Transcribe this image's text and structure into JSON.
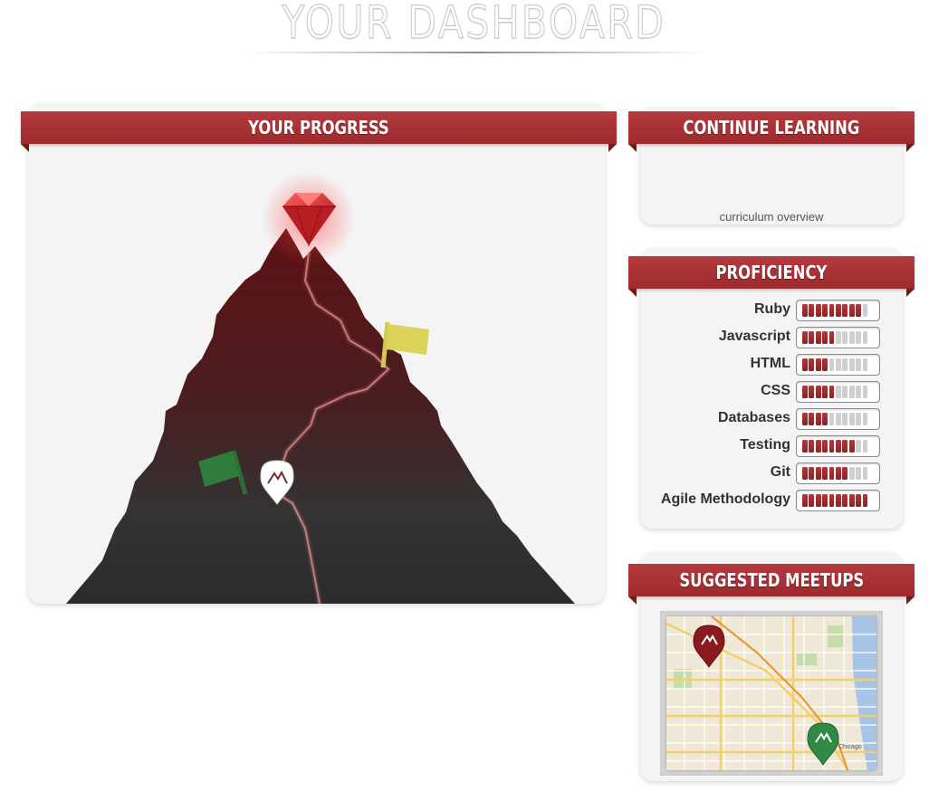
{
  "page": {
    "title": "YOUR DASHBOARD"
  },
  "progress": {
    "title": "YOUR PROGRESS"
  },
  "continue_learning": {
    "title": "CONTINUE LEARNING",
    "link_label": "curriculum overview"
  },
  "proficiency": {
    "title": "PROFICIENCY",
    "segments_per_meter": 10,
    "skills": [
      {
        "name": "Ruby",
        "level": 9
      },
      {
        "name": "Javascript",
        "level": 5
      },
      {
        "name": "HTML",
        "level": 4
      },
      {
        "name": "CSS",
        "level": 5
      },
      {
        "name": "Databases",
        "level": 4
      },
      {
        "name": "Testing",
        "level": 8
      },
      {
        "name": "Git",
        "level": 7
      },
      {
        "name": "Agile Methodology",
        "level": 10
      }
    ]
  },
  "meetups": {
    "title": "SUGGESTED MEETUPS",
    "map_labels": {
      "city": "Chicago"
    }
  },
  "colors": {
    "brand_red": "#a53035",
    "flag_yellow": "#dcd35a",
    "flag_green": "#2f7d3a",
    "gem_red": "#d0262c",
    "mountain_top": "#5a1417",
    "mountain_base": "#2e2e2e"
  },
  "icons": {
    "summit_marker": "ruby-gem-icon",
    "position_marker": "mountain-pin-icon"
  }
}
